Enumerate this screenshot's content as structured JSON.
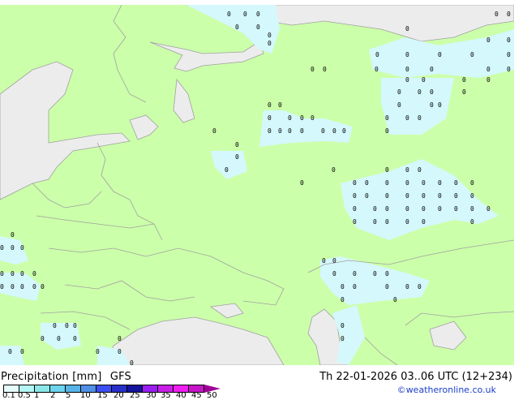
{
  "legend": {
    "title": "Precipitation [mm]",
    "model": "GFS",
    "datetime": "Th 22-01-2026 03..06 UTC (12+234)",
    "credit": "©weatheronline.co.uk",
    "scale_labels": [
      "0.1",
      "0.5",
      "1",
      "2",
      "5",
      "10",
      "15",
      "20",
      "25",
      "30",
      "35",
      "40",
      "45",
      "50"
    ],
    "scale_colors": [
      "#e6fcfc",
      "#b4f5f5",
      "#8ce8e8",
      "#6cd4ec",
      "#58b4e8",
      "#5090e6",
      "#3c4ff0",
      "#2830c8",
      "#14149c",
      "#9a1ef0",
      "#c81ee6",
      "#f01ef0",
      "#c814c8"
    ],
    "arrow_color": "#a0009a"
  },
  "map": {
    "land_color": "#ccffaa",
    "sea_color": "#ececec",
    "precip_color": "#d4f8fc",
    "border_color": "#a0a0a0"
  }
}
